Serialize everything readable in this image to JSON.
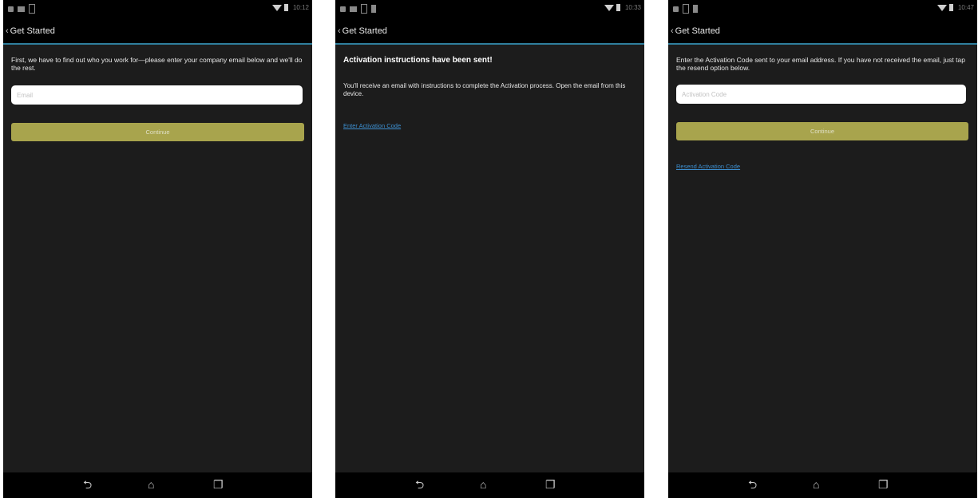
{
  "screens": [
    {
      "status": {
        "time": "10:12"
      },
      "action_bar": {
        "title": "Get Started"
      },
      "instruction": "First, we have to find out who you work for—please enter your company email below and we'll do the rest.",
      "email_field": {
        "placeholder": "Email"
      },
      "continue_button": {
        "label": "Continue"
      }
    },
    {
      "status": {
        "time": "10:33"
      },
      "action_bar": {
        "title": "Get Started"
      },
      "heading": "Activation instructions have been sent!",
      "body": "You'll receive an email with instructions to complete the Activation process. Open the email from this device.",
      "enter_code_link": "Enter Activation Code"
    },
    {
      "status": {
        "time": "10:47"
      },
      "action_bar": {
        "title": "Get Started"
      },
      "instruction": "Enter the Activation Code sent to your email address. If you have not received the email, just tap the resend option below.",
      "code_field": {
        "placeholder": "Activation Code"
      },
      "continue_button": {
        "label": "Continue"
      },
      "resend_link": "Resend Activation Code"
    }
  ],
  "nav_icons": {
    "back": "back-arrow-icon",
    "home": "home-icon",
    "recents": "recents-icon"
  },
  "colors": {
    "accent_line": "#2f7f9e",
    "button": "#a8a44d",
    "link": "#3d8fd0",
    "background": "#1c1c1c"
  }
}
